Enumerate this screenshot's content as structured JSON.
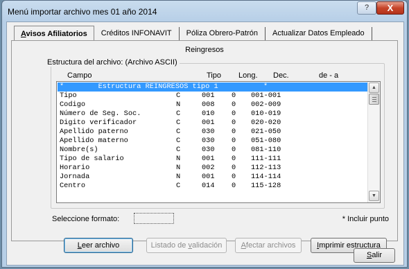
{
  "window": {
    "title": "Menú importar archivo mes 01 año 2014",
    "help_label": "?",
    "close_label": "X"
  },
  "tabs": [
    {
      "label": "Avisos Afiliatorios",
      "mnemonic": "A",
      "rest": "visos Afiliatorios",
      "active": true
    },
    {
      "label": "Créditos INFONAVIT",
      "active": false
    },
    {
      "label": "Póliza Obrero-Patrón",
      "active": false
    },
    {
      "label": "Actualizar Datos Empleado",
      "active": false
    }
  ],
  "section_title": "Reingresos",
  "structure_label": "Estructura del archivo:  (Archivo ASCII)",
  "columns": {
    "campo": "Campo",
    "tipo": "Tipo",
    "long": "Long.",
    "dec": "Dec.",
    "range": "de - a"
  },
  "rows": [
    {
      "campo": "*        Estructura REINGRESOS tipo 1",
      "tipo": "",
      "long": "",
      "dec": "",
      "range": "*",
      "selected": true
    },
    {
      "campo": "Tipo",
      "tipo": "C",
      "long": "001",
      "dec": "0",
      "range": "001-001"
    },
    {
      "campo": "Codigo",
      "tipo": "N",
      "long": "008",
      "dec": "0",
      "range": "002-009"
    },
    {
      "campo": "Número de Seg. Soc.",
      "tipo": "C",
      "long": "010",
      "dec": "0",
      "range": "010-019"
    },
    {
      "campo": "Digito verificador",
      "tipo": "C",
      "long": "001",
      "dec": "0",
      "range": "020-020"
    },
    {
      "campo": "Apellido paterno",
      "tipo": "C",
      "long": "030",
      "dec": "0",
      "range": "021-050"
    },
    {
      "campo": "Apellido materno",
      "tipo": "C",
      "long": "030",
      "dec": "0",
      "range": "051-080"
    },
    {
      "campo": "Nombre(s)",
      "tipo": "C",
      "long": "030",
      "dec": "0",
      "range": "081-110"
    },
    {
      "campo": "Tipo de salario",
      "tipo": "N",
      "long": "001",
      "dec": "0",
      "range": "111-111"
    },
    {
      "campo": "Horario",
      "tipo": "N",
      "long": "002",
      "dec": "0",
      "range": "112-113"
    },
    {
      "campo": "Jornada",
      "tipo": "N",
      "long": "001",
      "dec": "0",
      "range": "114-114"
    },
    {
      "campo": "Centro",
      "tipo": "C",
      "long": "014",
      "dec": "0",
      "range": "115-128"
    }
  ],
  "format": {
    "label": "Seleccione formato:",
    "value": ""
  },
  "incluir_punto": "* Incluir punto",
  "buttons": {
    "leer": {
      "mnemonic": "L",
      "rest": "eer archivo"
    },
    "listado": {
      "before": "Listado de ",
      "mnemonic": "v",
      "rest": "alidación"
    },
    "afectar": {
      "mnemonic": "A",
      "rest": "fectar archivos"
    },
    "imprimir": {
      "mnemonic": "I",
      "rest": "mprimir estructura"
    },
    "salir": {
      "mnemonic": "S",
      "rest": "alir"
    }
  },
  "scrollbar_icons": {
    "up": "scroll-up-arrow-icon",
    "down": "scroll-down-arrow-icon"
  }
}
